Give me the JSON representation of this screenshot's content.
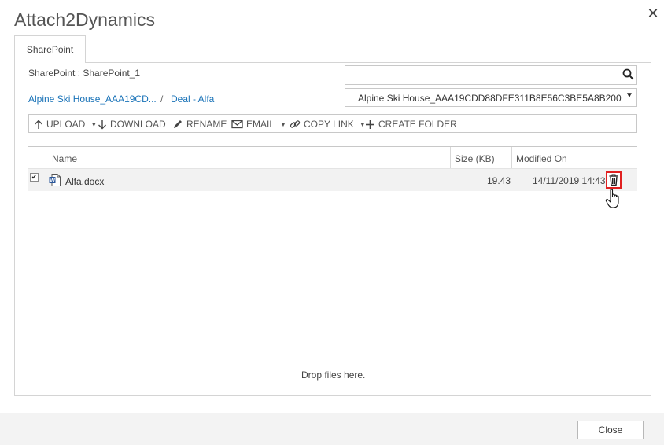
{
  "dialog": {
    "title": "Attach2Dynamics"
  },
  "tabs": [
    {
      "label": "SharePoint"
    }
  ],
  "site": {
    "label": "SharePoint : SharePoint_1"
  },
  "search": {
    "value": "",
    "placeholder": ""
  },
  "breadcrumb": {
    "items": [
      "Alpine Ski House_AAA19CD...",
      "Deal - Alfa"
    ],
    "separator": "/"
  },
  "folder_select": {
    "selected": "Alpine Ski House_AAA19CDD88DFE311B8E56C3BE5A8B200"
  },
  "toolbar": {
    "upload": "UPLOAD",
    "download": "DOWNLOAD",
    "rename": "RENAME",
    "email": "EMAIL",
    "copy_link": "COPY LINK",
    "create_folder": "CREATE FOLDER"
  },
  "table": {
    "columns": [
      "Name",
      "Size (KB)",
      "Modified On"
    ],
    "rows": [
      {
        "checked": true,
        "name": "Alfa.docx",
        "size": "19.43",
        "modified": "14/11/2019 14:43"
      }
    ]
  },
  "drop_zone": {
    "text": "Drop files here."
  },
  "footer": {
    "close_label": "Close"
  },
  "colors": {
    "link": "#1a73b8",
    "highlight_border": "#e02020",
    "word_blue": "#2b579a"
  }
}
